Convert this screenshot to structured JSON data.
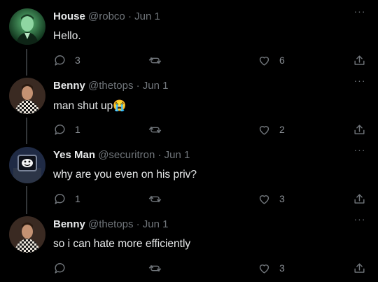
{
  "tweets": [
    {
      "name": "House",
      "handle": "@robco",
      "dot": "·",
      "date": "Jun 1",
      "text": "Hello.",
      "replies": "3",
      "likes": "6",
      "avatar": "house-avatar"
    },
    {
      "name": "Benny",
      "handle": "@thetops",
      "dot": "·",
      "date": "Jun 1",
      "text": "man shut up😭",
      "replies": "1",
      "likes": "2",
      "avatar": "benny-avatar"
    },
    {
      "name": "Yes Man",
      "handle": "@securitron",
      "dot": "·",
      "date": "Jun 1",
      "text": "why are you even on his priv?",
      "replies": "1",
      "likes": "3",
      "avatar": "yesman-avatar"
    },
    {
      "name": "Benny",
      "handle": "@thetops",
      "dot": "·",
      "date": "Jun 1",
      "text": "so i can hate more efficiently",
      "replies": "",
      "likes": "3",
      "avatar": "benny-avatar"
    }
  ],
  "more_icon": "···",
  "icons": {
    "reply": "reply-icon",
    "retweet": "retweet-icon",
    "like": "heart-icon",
    "share": "share-icon",
    "more": "more-icon"
  },
  "colors": {
    "background": "#000000",
    "text": "#e7e9ea",
    "muted": "#71767b",
    "thread_line": "#333639"
  }
}
